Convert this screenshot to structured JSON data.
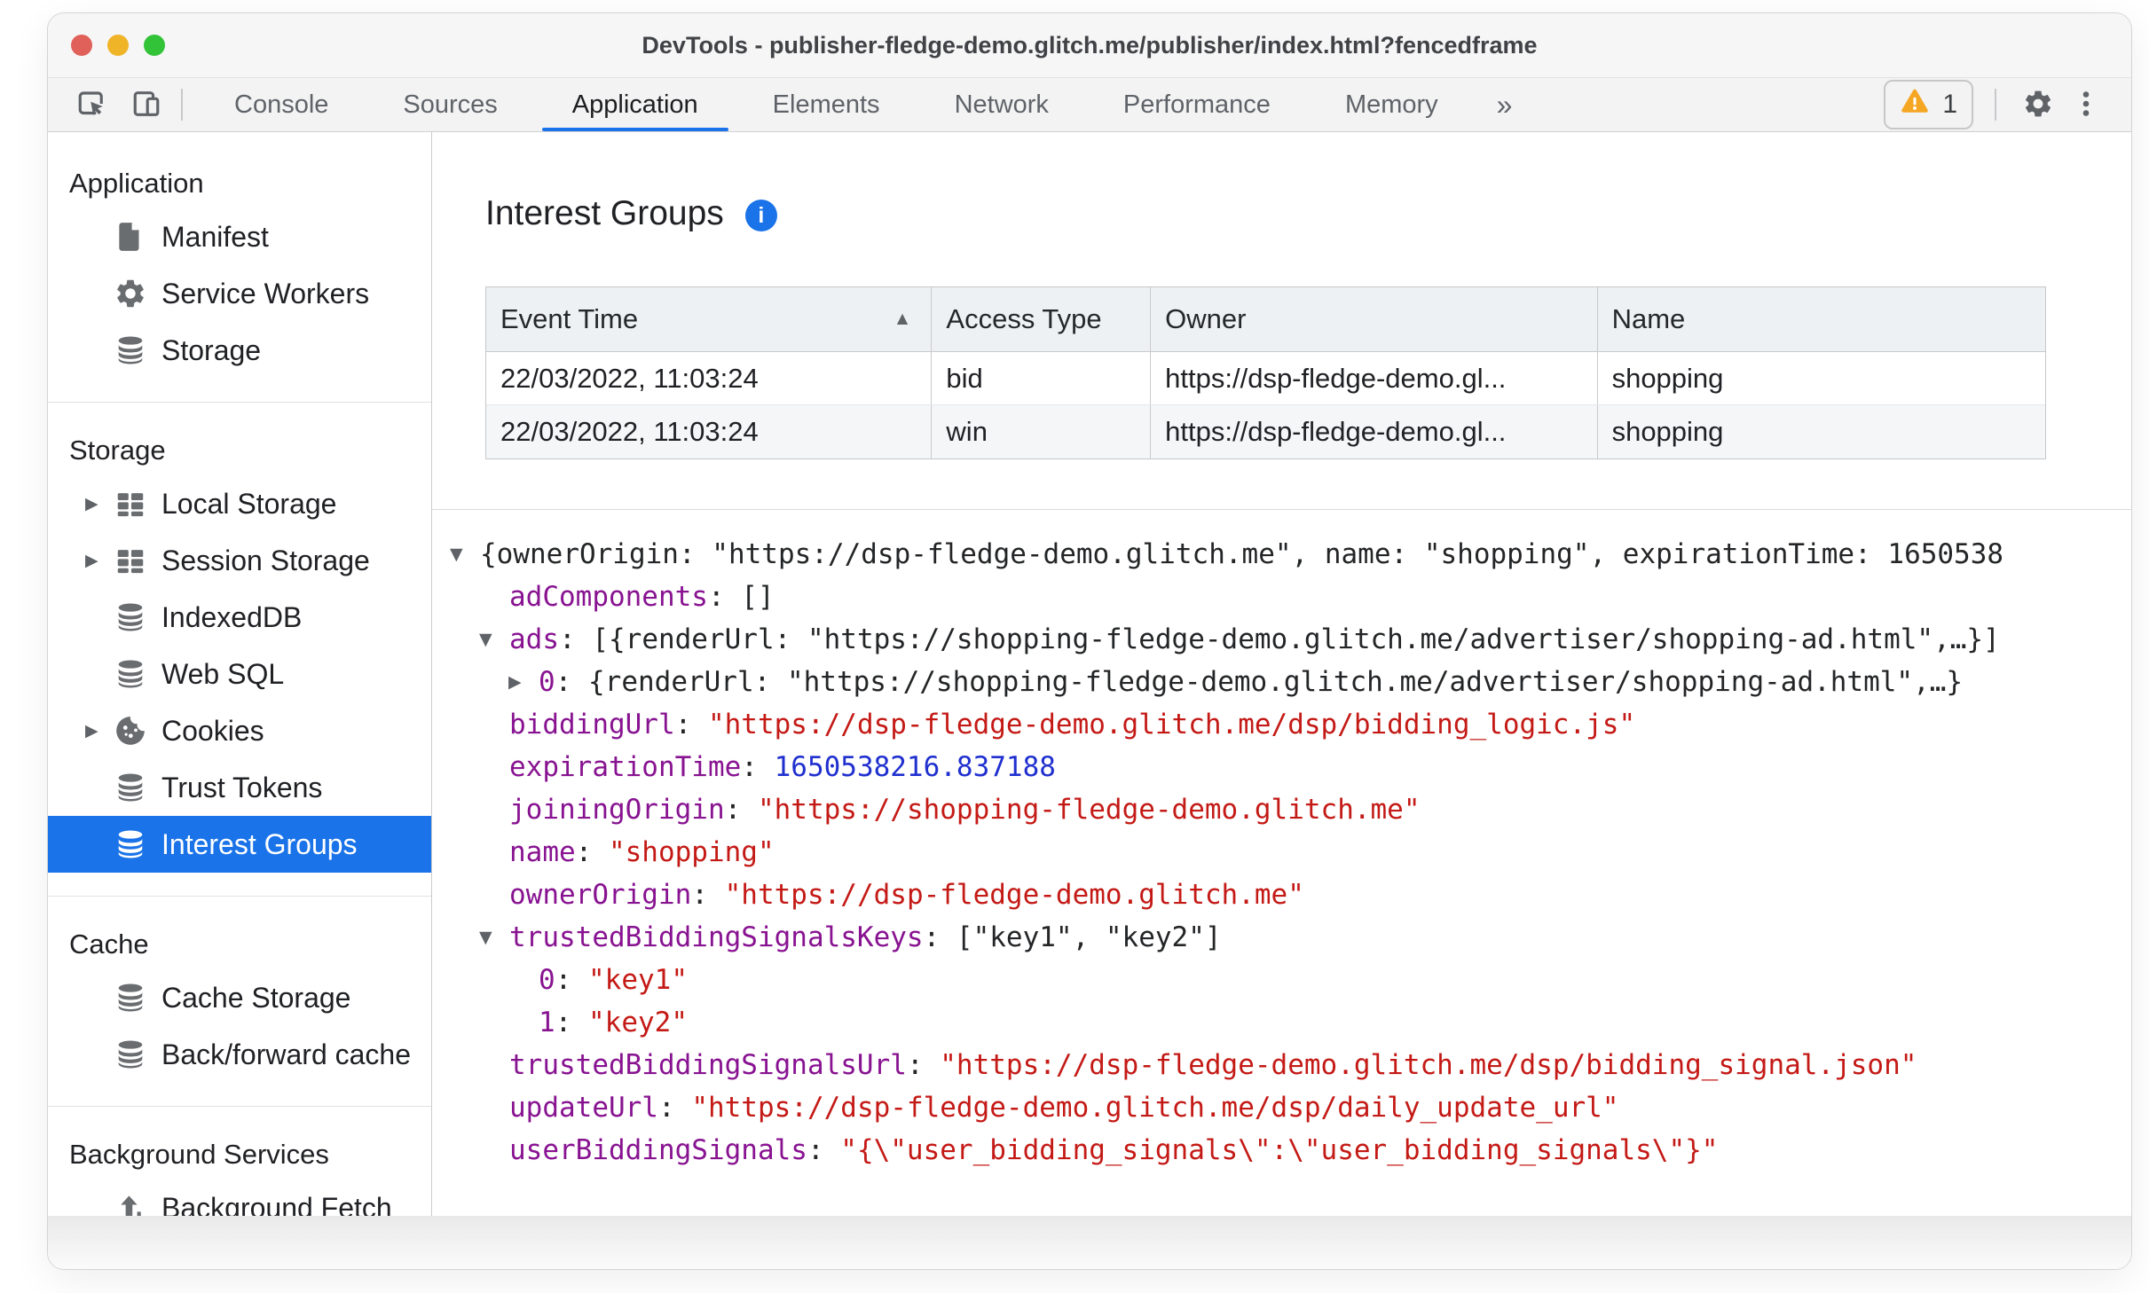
{
  "titlebar": {
    "title": "DevTools - publisher-fledge-demo.glitch.me/publisher/index.html?fencedframe"
  },
  "toolbar": {
    "left_icons": [
      "inspect-icon",
      "device-toolbar-icon"
    ],
    "tabs": [
      "Console",
      "Sources",
      "Application",
      "Elements",
      "Network",
      "Performance",
      "Memory"
    ],
    "selected_tab": "Application",
    "overflow_chevron": "»",
    "warning_count": "1",
    "right_icons": [
      "warning-icon",
      "settings-gear-icon",
      "kebab-menu-icon"
    ]
  },
  "sidebar": {
    "selected_item": "Interest Groups",
    "sections": [
      {
        "title": "Application",
        "items": [
          {
            "label": "Manifest",
            "icon": "file-icon",
            "expandable": false,
            "selected": false
          },
          {
            "label": "Service Workers",
            "icon": "gear-icon",
            "expandable": false,
            "selected": false
          },
          {
            "label": "Storage",
            "icon": "database-icon",
            "expandable": false,
            "selected": false
          }
        ]
      },
      {
        "title": "Storage",
        "items": [
          {
            "label": "Local Storage",
            "icon": "table-icon",
            "expandable": true,
            "selected": false
          },
          {
            "label": "Session Storage",
            "icon": "table-icon",
            "expandable": true,
            "selected": false
          },
          {
            "label": "IndexedDB",
            "icon": "database-icon",
            "expandable": false,
            "selected": false
          },
          {
            "label": "Web SQL",
            "icon": "database-icon",
            "expandable": false,
            "selected": false
          },
          {
            "label": "Cookies",
            "icon": "cookie-icon",
            "expandable": true,
            "selected": false
          },
          {
            "label": "Trust Tokens",
            "icon": "database-icon",
            "expandable": false,
            "selected": false
          },
          {
            "label": "Interest Groups",
            "icon": "database-icon",
            "expandable": false,
            "selected": true
          }
        ]
      },
      {
        "title": "Cache",
        "items": [
          {
            "label": "Cache Storage",
            "icon": "database-icon",
            "expandable": false,
            "selected": false
          },
          {
            "label": "Back/forward cache",
            "icon": "database-icon",
            "expandable": false,
            "selected": false
          }
        ]
      },
      {
        "title": "Background Services",
        "items": [
          {
            "label": "Background Fetch",
            "icon": "fetch-arrows-icon",
            "expandable": false,
            "selected": false
          }
        ]
      }
    ]
  },
  "main": {
    "heading": "Interest Groups",
    "info_icon_glyph": "i",
    "table": {
      "columns": [
        "Event Time",
        "Access Type",
        "Owner",
        "Name"
      ],
      "sort_column": "Event Time",
      "sort_direction": "ascending",
      "sort_indicator": "▲",
      "rows": [
        [
          "22/03/2022, 11:03:24",
          "bid",
          "https://dsp-fledge-demo.gl...",
          "shopping"
        ],
        [
          "22/03/2022, 11:03:24",
          "win",
          "https://dsp-fledge-demo.gl...",
          "shopping"
        ]
      ]
    },
    "json_tree": {
      "lines": [
        {
          "level": 0,
          "toggle": "open",
          "segments": [
            {
              "type": "plain",
              "text": "{ownerOrigin: \"https://dsp-fledge-demo.glitch.me\", name: \"shopping\", expirationTime: 1650538"
            }
          ]
        },
        {
          "level": 1,
          "toggle": null,
          "segments": [
            {
              "type": "key",
              "text": "adComponents"
            },
            {
              "type": "plain",
              "text": ": []"
            }
          ]
        },
        {
          "level": 1,
          "toggle": "open",
          "segments": [
            {
              "type": "key",
              "text": "ads"
            },
            {
              "type": "plain",
              "text": ": [{renderUrl: \"https://shopping-fledge-demo.glitch.me/advertiser/shopping-ad.html\",…}]"
            }
          ]
        },
        {
          "level": 2,
          "toggle": "closed",
          "segments": [
            {
              "type": "key",
              "text": "0"
            },
            {
              "type": "plain",
              "text": ": {renderUrl: \"https://shopping-fledge-demo.glitch.me/advertiser/shopping-ad.html\",…}"
            }
          ]
        },
        {
          "level": 1,
          "toggle": null,
          "segments": [
            {
              "type": "key",
              "text": "biddingUrl"
            },
            {
              "type": "plain",
              "text": ": "
            },
            {
              "type": "string",
              "text": "\"https://dsp-fledge-demo.glitch.me/dsp/bidding_logic.js\""
            }
          ]
        },
        {
          "level": 1,
          "toggle": null,
          "segments": [
            {
              "type": "key",
              "text": "expirationTime"
            },
            {
              "type": "plain",
              "text": ": "
            },
            {
              "type": "number",
              "text": "1650538216.837188"
            }
          ]
        },
        {
          "level": 1,
          "toggle": null,
          "segments": [
            {
              "type": "key",
              "text": "joiningOrigin"
            },
            {
              "type": "plain",
              "text": ": "
            },
            {
              "type": "string",
              "text": "\"https://shopping-fledge-demo.glitch.me\""
            }
          ]
        },
        {
          "level": 1,
          "toggle": null,
          "segments": [
            {
              "type": "key",
              "text": "name"
            },
            {
              "type": "plain",
              "text": ": "
            },
            {
              "type": "string",
              "text": "\"shopping\""
            }
          ]
        },
        {
          "level": 1,
          "toggle": null,
          "segments": [
            {
              "type": "key",
              "text": "ownerOrigin"
            },
            {
              "type": "plain",
              "text": ": "
            },
            {
              "type": "string",
              "text": "\"https://dsp-fledge-demo.glitch.me\""
            }
          ]
        },
        {
          "level": 1,
          "toggle": "open",
          "segments": [
            {
              "type": "key",
              "text": "trustedBiddingSignalsKeys"
            },
            {
              "type": "plain",
              "text": ": [\"key1\", \"key2\"]"
            }
          ]
        },
        {
          "level": 2,
          "toggle": null,
          "segments": [
            {
              "type": "key",
              "text": "0"
            },
            {
              "type": "plain",
              "text": ": "
            },
            {
              "type": "string",
              "text": "\"key1\""
            }
          ]
        },
        {
          "level": 2,
          "toggle": null,
          "segments": [
            {
              "type": "key",
              "text": "1"
            },
            {
              "type": "plain",
              "text": ": "
            },
            {
              "type": "string",
              "text": "\"key2\""
            }
          ]
        },
        {
          "level": 1,
          "toggle": null,
          "segments": [
            {
              "type": "key",
              "text": "trustedBiddingSignalsUrl"
            },
            {
              "type": "plain",
              "text": ": "
            },
            {
              "type": "string",
              "text": "\"https://dsp-fledge-demo.glitch.me/dsp/bidding_signal.json\""
            }
          ]
        },
        {
          "level": 1,
          "toggle": null,
          "segments": [
            {
              "type": "key",
              "text": "updateUrl"
            },
            {
              "type": "plain",
              "text": ": "
            },
            {
              "type": "string",
              "text": "\"https://dsp-fledge-demo.glitch.me/dsp/daily_update_url\""
            }
          ]
        },
        {
          "level": 1,
          "toggle": null,
          "segments": [
            {
              "type": "key",
              "text": "userBiddingSignals"
            },
            {
              "type": "plain",
              "text": ": "
            },
            {
              "type": "string",
              "text": "\"{\\\"user_bidding_signals\\\":\\\"user_bidding_signals\\\"}\""
            }
          ]
        }
      ]
    }
  },
  "colors": {
    "accent_blue": "#1a73e8",
    "selected_row_bg": "#1a73e8",
    "json_key": "#881391",
    "json_string": "#c41a16",
    "json_number": "#2030cf",
    "warning_orange": "#f5a623",
    "toolbar_bg": "#f3f3f4",
    "table_header_bg": "#eef1f3"
  }
}
